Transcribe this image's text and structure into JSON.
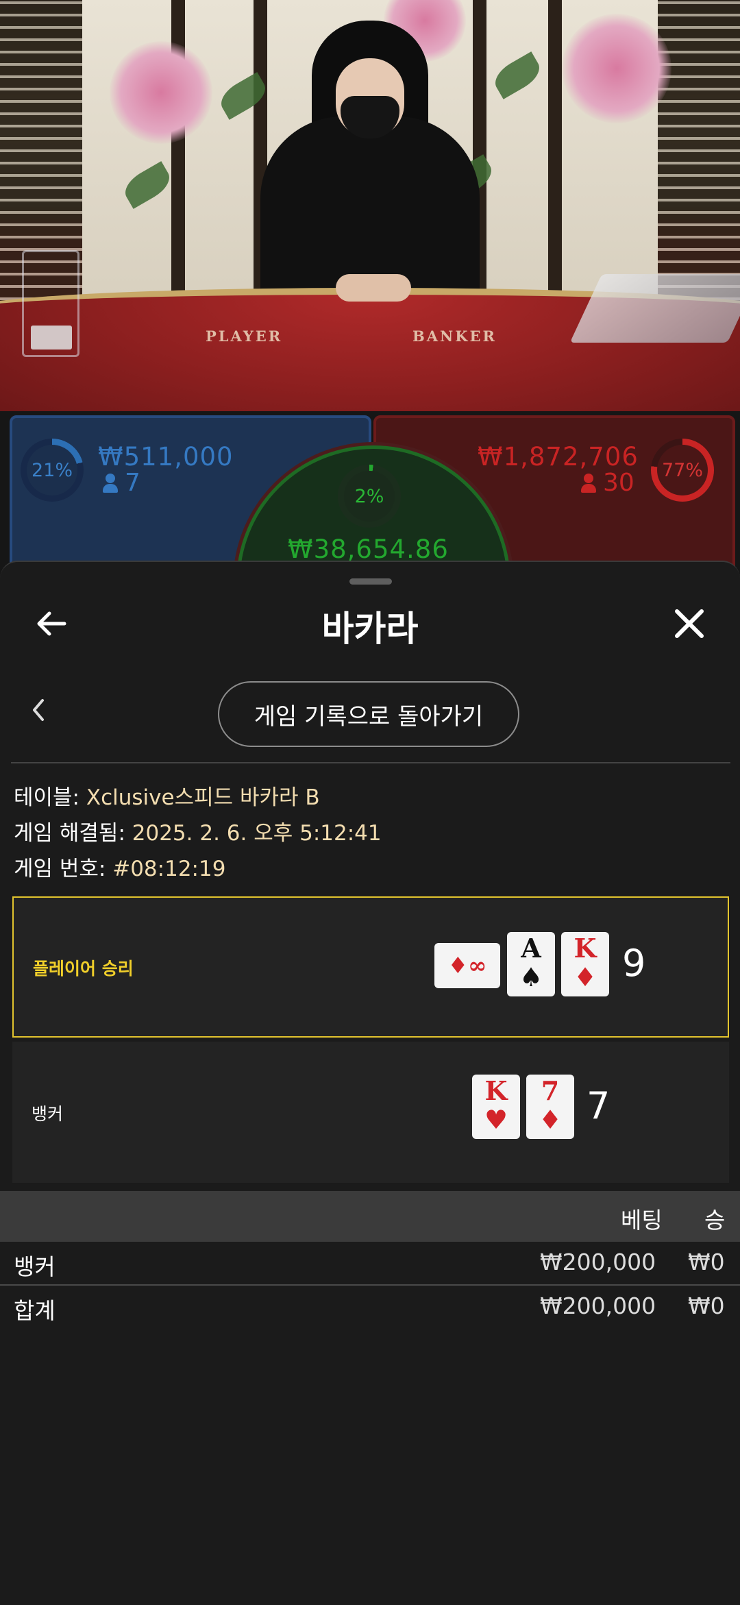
{
  "video": {
    "table_labels": {
      "player": "PLAYER",
      "banker": "BANKER"
    }
  },
  "stats": {
    "player": {
      "percent": "21%",
      "percent_value": 21,
      "amount": "₩511,000",
      "players": "7",
      "color": "#2c6fb4"
    },
    "tie": {
      "percent": "2%",
      "percent_value": 2,
      "amount": "₩38,654.86",
      "color": "#23a82f"
    },
    "banker": {
      "percent": "77%",
      "percent_value": 77,
      "amount": "₩1,872,706",
      "players": "30",
      "color": "#c92424"
    }
  },
  "sheet": {
    "title": "바카라",
    "history_button": "게임 기록으로 돌아가기",
    "info": {
      "table_label": "테이블: ",
      "table_value": "Xclusive스피드 바카라 B",
      "resolved_label": "게임 해결됨: ",
      "resolved_value": "2025. 2. 6. 오후 5:12:41",
      "number_label": "게임 번호: ",
      "number_value": "#08:12:19"
    },
    "player_result": {
      "label": "플레이어 승리",
      "score": "9",
      "cards": [
        {
          "rank": "∞",
          "suit": "♦",
          "sideways": true
        },
        {
          "rank": "A",
          "suit": "♠"
        },
        {
          "rank": "K",
          "suit": "♦"
        }
      ]
    },
    "banker_result": {
      "label": "뱅커",
      "score": "7",
      "cards": [
        {
          "rank": "K",
          "suit": "♥"
        },
        {
          "rank": "7",
          "suit": "♦"
        }
      ]
    },
    "bets_table": {
      "headers": {
        "bet": "베팅",
        "win": "승"
      },
      "rows": [
        {
          "name": "뱅커",
          "bet": "₩200,000",
          "win": "₩0"
        }
      ],
      "total": {
        "name": "합계",
        "bet": "₩200,000",
        "win": "₩0"
      }
    },
    "colors": {
      "winner_border": "#e2c42e",
      "winner_text": "#f1cf2a",
      "info_value": "#f3ddb0"
    }
  },
  "icons": {
    "back": "arrow-left-icon",
    "close": "close-icon",
    "chevron": "chevron-left-icon",
    "players": "person-icon"
  }
}
